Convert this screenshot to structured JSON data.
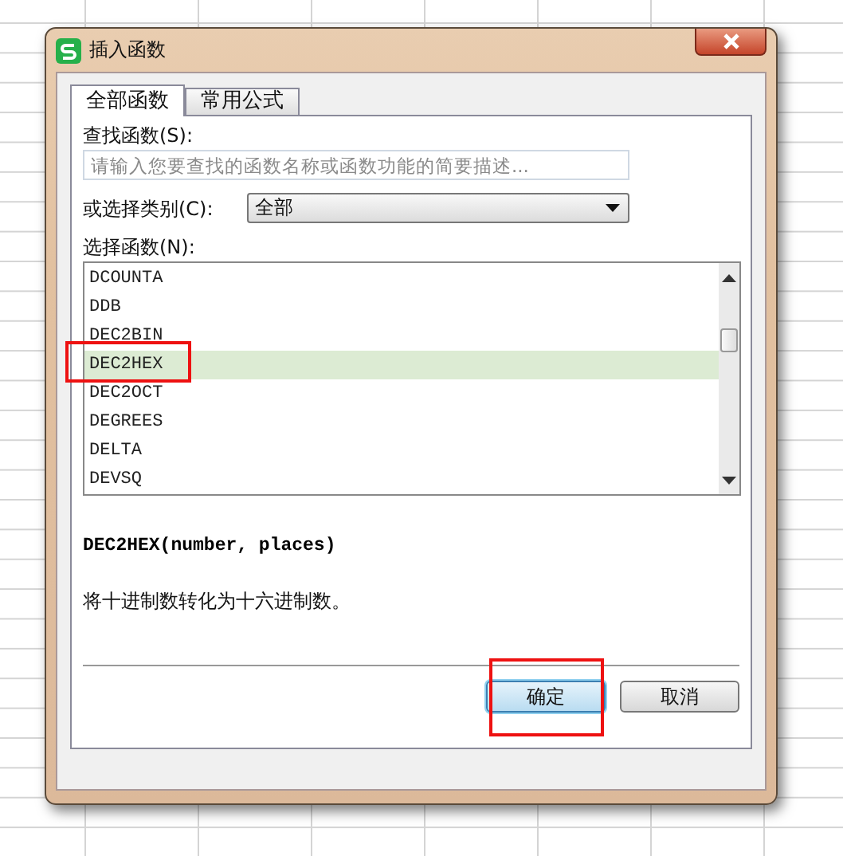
{
  "window": {
    "title": "插入函数"
  },
  "tabs": [
    {
      "label": "全部函数",
      "selected": true
    },
    {
      "label": "常用公式",
      "selected": false
    }
  ],
  "search": {
    "label": "查找函数(S):",
    "placeholder": "请输入您要查找的函数名称或函数功能的简要描述..."
  },
  "category": {
    "label": "或选择类别(C):",
    "value": "全部"
  },
  "function_list": {
    "label": "选择函数(N):",
    "items": [
      {
        "name": "DCOUNTA",
        "selected": false,
        "highlighted": false
      },
      {
        "name": "DDB",
        "selected": false,
        "highlighted": false
      },
      {
        "name": "DEC2BIN",
        "selected": false,
        "highlighted": false
      },
      {
        "name": "DEC2HEX",
        "selected": true,
        "highlighted": true
      },
      {
        "name": "DEC2OCT",
        "selected": false,
        "highlighted": false
      },
      {
        "name": "DEGREES",
        "selected": false,
        "highlighted": false
      },
      {
        "name": "DELTA",
        "selected": false,
        "highlighted": false
      },
      {
        "name": "DEVSQ",
        "selected": false,
        "highlighted": false
      }
    ]
  },
  "signature": "DEC2HEX(number, places)",
  "description": "将十进制数转化为十六进制数。",
  "buttons": [
    {
      "label": "确定",
      "default": true,
      "highlighted": true
    },
    {
      "label": "取消",
      "default": false,
      "highlighted": false
    }
  ]
}
